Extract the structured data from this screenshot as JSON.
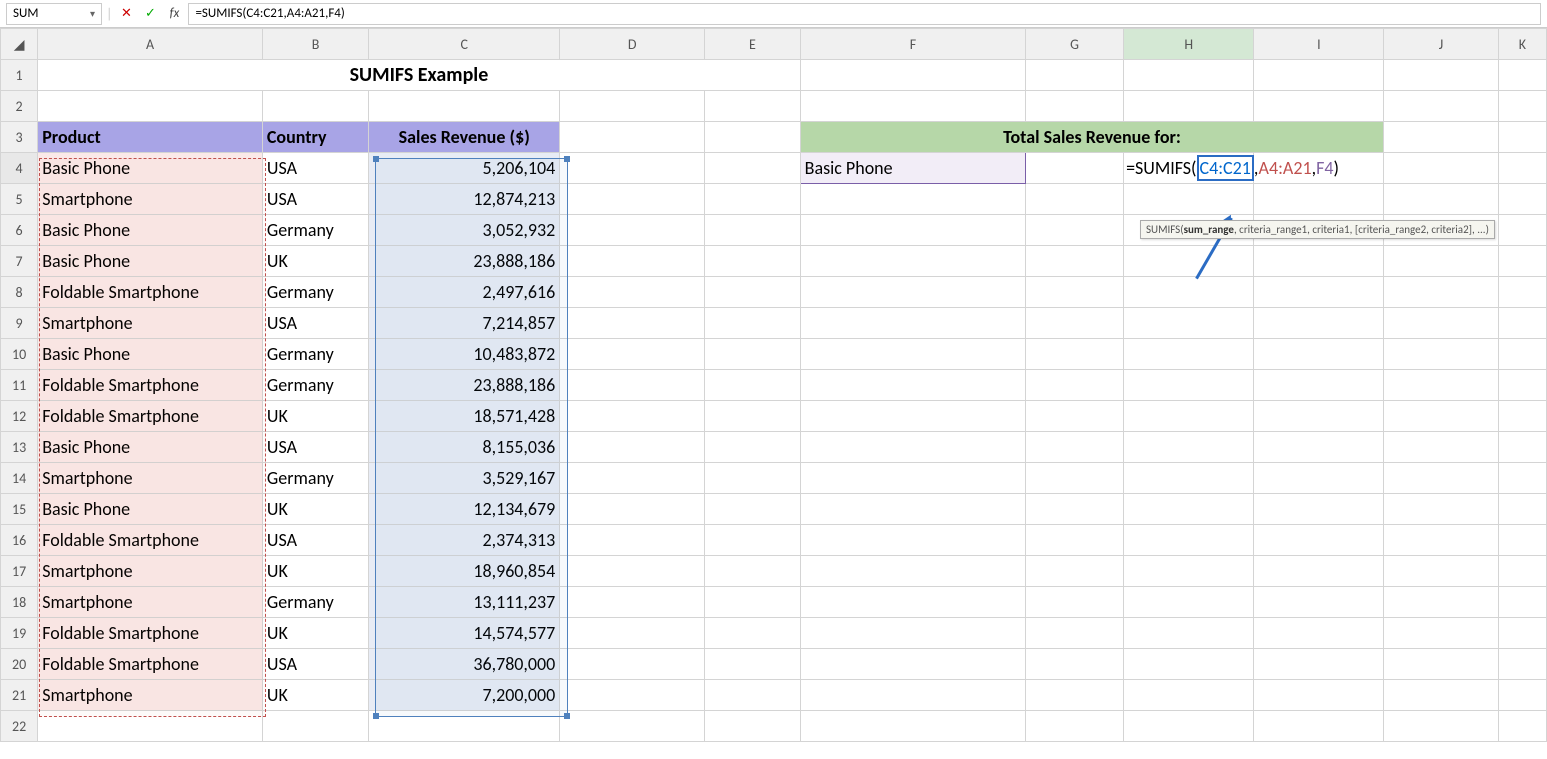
{
  "nameBox": "SUM",
  "formulaBar": "=SUMIFS(C4:C21,A4:A21,F4)",
  "columns": [
    "A",
    "B",
    "C",
    "D",
    "E",
    "F",
    "G",
    "H",
    "I",
    "J",
    "K"
  ],
  "title": "SUMIFS Example",
  "headers": {
    "product": "Product",
    "country": "Country",
    "revenue": "Sales Revenue ($)"
  },
  "greenHeader": "Total Sales Revenue for:",
  "lookupValue": "Basic Phone",
  "formulaParts": {
    "pre": "=SUMIFS(",
    "arg1": "C4:C21",
    "sep1": ",",
    "arg2": "A4:A21",
    "sep2": ",",
    "arg3": "F4",
    "post": ")"
  },
  "tooltip": {
    "fn": "SUMIFS(",
    "bold": "sum_range",
    "rest": ", criteria_range1, criteria1, [criteria_range2, criteria2], ...)"
  },
  "rows": [
    {
      "p": "Basic Phone",
      "c": "USA",
      "r": "5,206,104"
    },
    {
      "p": "Smartphone",
      "c": "USA",
      "r": "12,874,213"
    },
    {
      "p": "Basic Phone",
      "c": "Germany",
      "r": "3,052,932"
    },
    {
      "p": "Basic Phone",
      "c": "UK",
      "r": "23,888,186"
    },
    {
      "p": "Foldable Smartphone",
      "c": "Germany",
      "r": "2,497,616"
    },
    {
      "p": "Smartphone",
      "c": "USA",
      "r": "7,214,857"
    },
    {
      "p": "Basic Phone",
      "c": "Germany",
      "r": "10,483,872"
    },
    {
      "p": "Foldable Smartphone",
      "c": "Germany",
      "r": "23,888,186"
    },
    {
      "p": "Foldable Smartphone",
      "c": "UK",
      "r": "18,571,428"
    },
    {
      "p": "Basic Phone",
      "c": "USA",
      "r": "8,155,036"
    },
    {
      "p": "Smartphone",
      "c": "Germany",
      "r": "3,529,167"
    },
    {
      "p": "Basic Phone",
      "c": "UK",
      "r": "12,134,679"
    },
    {
      "p": "Foldable Smartphone",
      "c": "USA",
      "r": "2,374,313"
    },
    {
      "p": "Smartphone",
      "c": "UK",
      "r": "18,960,854"
    },
    {
      "p": "Smartphone",
      "c": "Germany",
      "r": "13,111,237"
    },
    {
      "p": "Foldable Smartphone",
      "c": "UK",
      "r": "14,574,577"
    },
    {
      "p": "Foldable Smartphone",
      "c": "USA",
      "r": "36,780,000"
    },
    {
      "p": "Smartphone",
      "c": "UK",
      "r": "7,200,000"
    }
  ]
}
